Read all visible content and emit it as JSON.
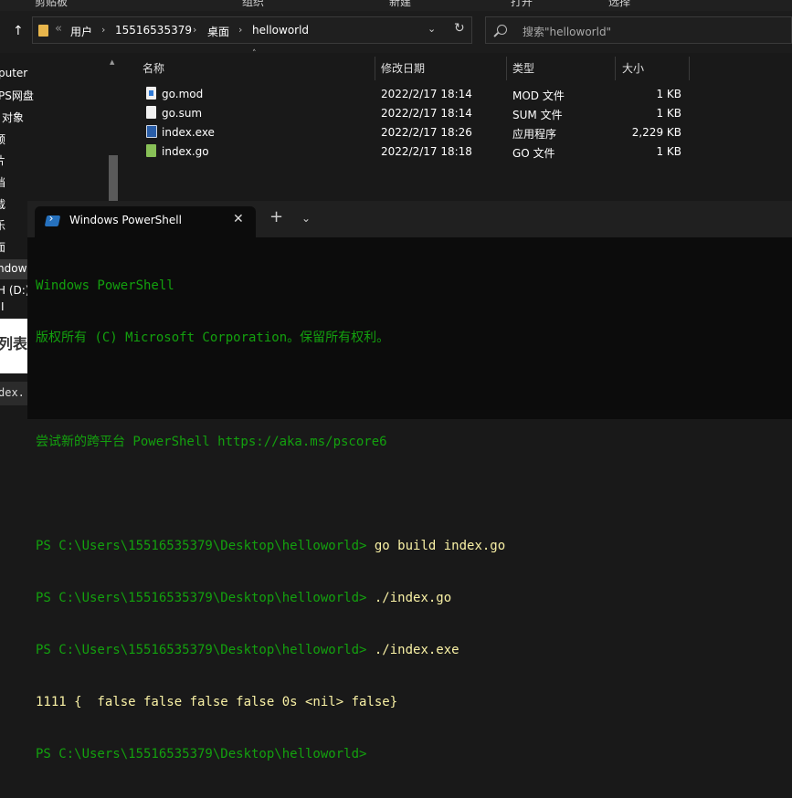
{
  "ribbon": {
    "labels": [
      "剪贴板",
      "组织",
      "新建",
      "打开",
      "选择"
    ]
  },
  "address_bar": {
    "breadcrumbs": [
      "用户",
      "15516535379",
      "桌面",
      "helloworld"
    ],
    "overflow_glyph": "«",
    "separator": "›",
    "dropdown_glyph": "⌄",
    "refresh_glyph": "↻",
    "up_glyph": "↑"
  },
  "search": {
    "placeholder": "搜索\"helloworld\""
  },
  "sidebar": {
    "items": [
      "puter",
      "PS网盘",
      "对象",
      "预",
      "片",
      "档",
      "载",
      "乐",
      "面",
      "ndow",
      "H (D:)",
      "I"
    ]
  },
  "file_list": {
    "columns": {
      "name": "名称",
      "date": "修改日期",
      "type": "类型",
      "size": "大小"
    },
    "rows": [
      {
        "name": "go.mod",
        "date": "2022/2/17 18:14",
        "type": "MOD 文件",
        "size": "1 KB",
        "icon": "go-mod-file-icon"
      },
      {
        "name": "go.sum",
        "date": "2022/2/17 18:14",
        "type": "SUM 文件",
        "size": "1 KB",
        "icon": "file-icon"
      },
      {
        "name": "index.exe",
        "date": "2022/2/17 18:26",
        "type": "应用程序",
        "size": "2,229 KB",
        "icon": "exe-icon"
      },
      {
        "name": "index.go",
        "date": "2022/2/17 18:18",
        "type": "GO 文件",
        "size": "1 KB",
        "icon": "go-source-icon"
      }
    ]
  },
  "left_fragments": {
    "card_text": "列表",
    "code_text": "dex."
  },
  "terminal": {
    "tab_title": "Windows PowerShell",
    "close_glyph": "✕",
    "new_tab_glyph": "+",
    "dropdown_glyph": "⌄",
    "lines": {
      "l1": "Windows PowerShell",
      "l2": "版权所有 (C) Microsoft Corporation。保留所有权利。",
      "l3": "",
      "l4": "尝试新的跨平台 PowerShell https://aka.ms/pscore6",
      "l5": "",
      "prompt": "PS C:\\Users\\15516535379\\Desktop\\helloworld> ",
      "cmd1": "go build index.go",
      "cmd2": "./index.go",
      "cmd3": "./index.exe",
      "output": "1111 {  false false false false 0s <nil> false}"
    }
  },
  "colors": {
    "console_green": "#13a10e",
    "console_yellow": "#f9f1a5",
    "console_bg": "#0c0c0c",
    "explorer_bg": "#191919"
  }
}
